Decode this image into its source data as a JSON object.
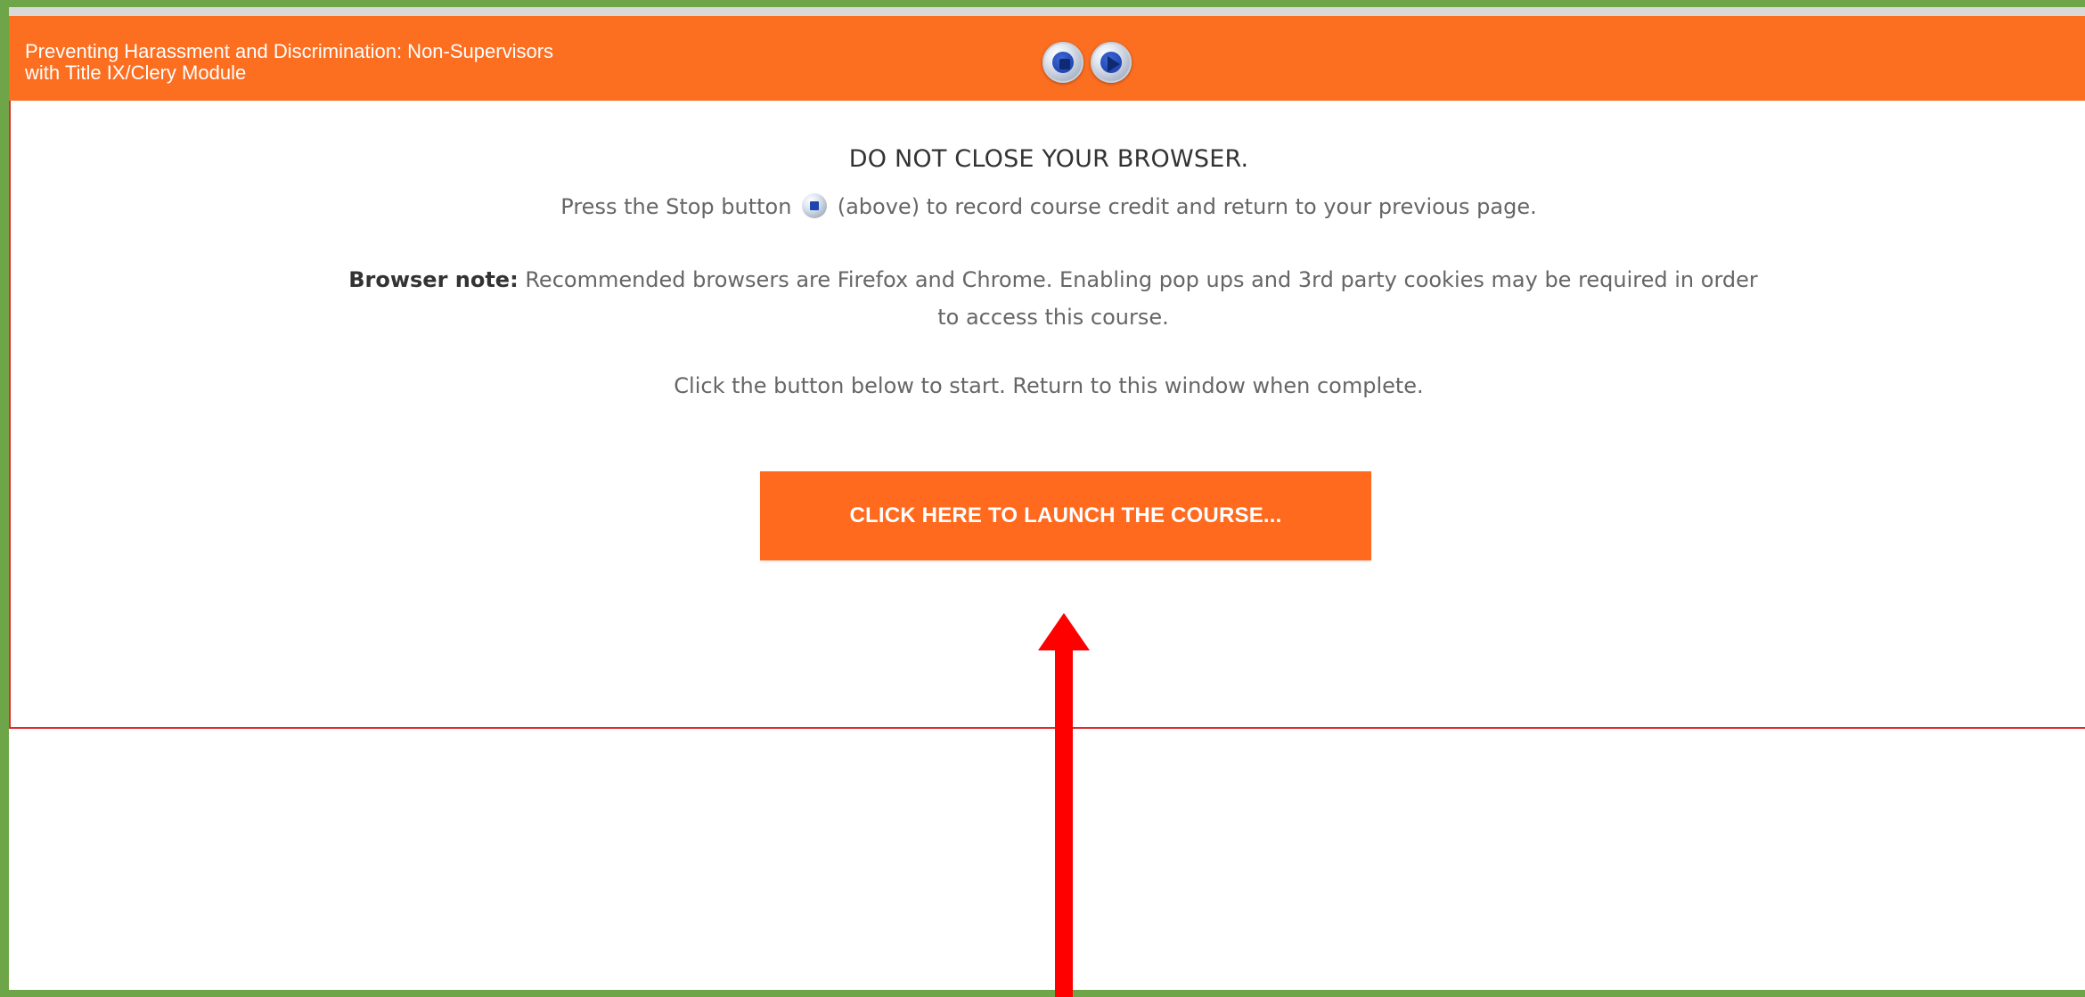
{
  "header": {
    "title": "Preventing Harassment and Discrimination: Non-Supervisors\nwith Title IX/Clery Module"
  },
  "controls": {
    "stop_icon": "stop-icon",
    "play_icon": "play-icon"
  },
  "content": {
    "warning": "DO NOT CLOSE YOUR BROWSER.",
    "stop_text_before": "Press the Stop button",
    "stop_text_after": "(above) to record course credit and return to your previous page.",
    "browser_note_label": "Browser note:",
    "browser_note_text": "Recommended browsers are Firefox and Chrome. Enabling pop ups and 3rd party cookies may be required in order to access this course.",
    "instruction": "Click the button below to start. Return to this window when complete.",
    "launch_button": "CLICK HERE TO LAUNCH THE COURSE..."
  },
  "colors": {
    "accent": "#fc6e20",
    "frame": "#6ea548",
    "annotation_arrow": "#ff0000"
  }
}
